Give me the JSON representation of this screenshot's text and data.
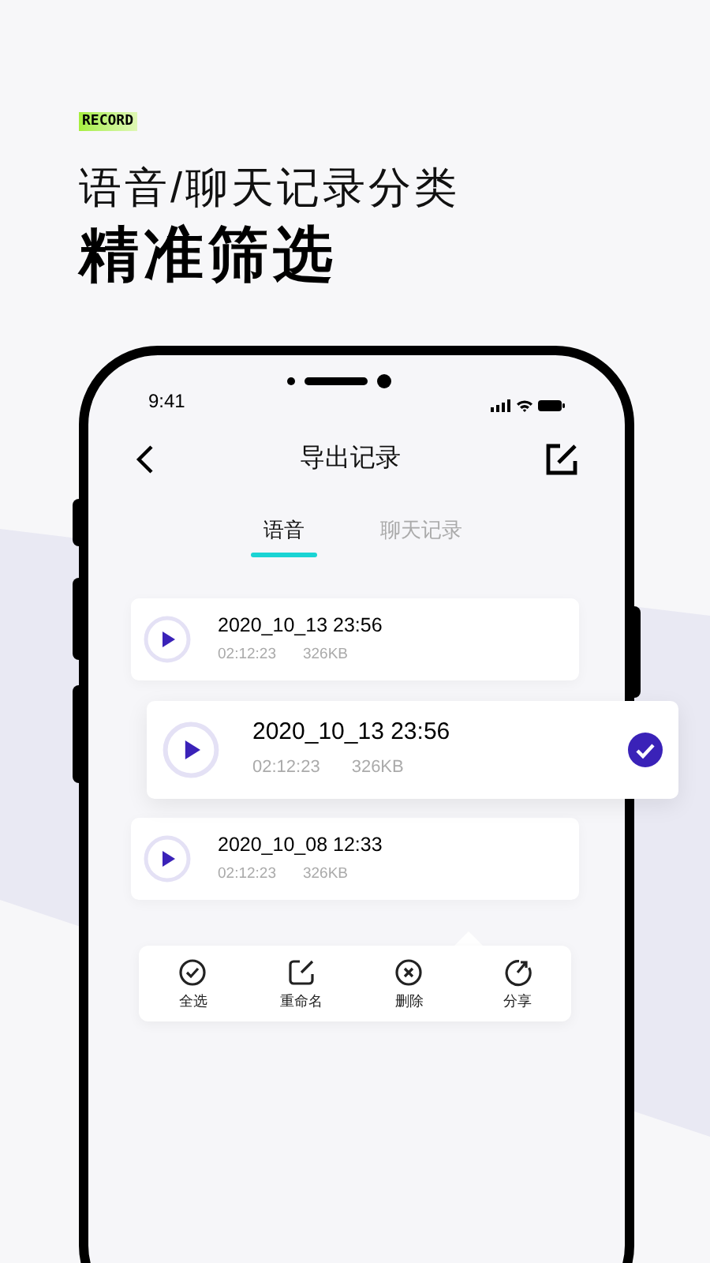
{
  "badge": "RECORD",
  "headline": "语音/聊天记录分类",
  "subheadline": "精准筛选",
  "status_bar": {
    "time": "9:41"
  },
  "nav": {
    "title": "导出记录"
  },
  "tabs": [
    {
      "label": "语音",
      "selected": true
    },
    {
      "label": "聊天记录",
      "selected": false
    }
  ],
  "records": [
    {
      "title": "2020_10_13 23:56",
      "duration": "02:12:23",
      "size": "326KB",
      "selected": false
    },
    {
      "title": "2020_10_13 23:56",
      "duration": "02:12:23",
      "size": "326KB",
      "selected": true
    },
    {
      "title": "2020_10_08 12:33",
      "duration": "02:12:23",
      "size": "326KB",
      "selected": false
    }
  ],
  "actions": [
    {
      "kind": "select_all",
      "label": "全选"
    },
    {
      "kind": "rename",
      "label": "重命名"
    },
    {
      "kind": "delete",
      "label": "删除"
    },
    {
      "kind": "share",
      "label": "分享"
    }
  ]
}
